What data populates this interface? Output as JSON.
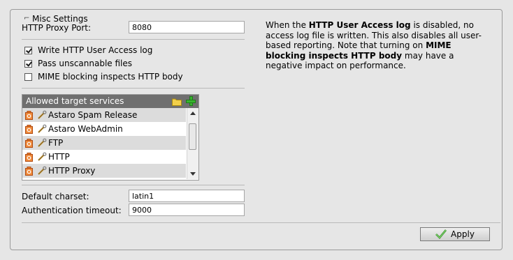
{
  "panel": {
    "title": "Misc Settings"
  },
  "proxy_port": {
    "label": "HTTP Proxy Port:",
    "value": "8080"
  },
  "checkboxes": [
    {
      "label": "Write HTTP User Access log",
      "checked": true
    },
    {
      "label": "Pass unscannable files",
      "checked": true
    },
    {
      "label": "MIME blocking inspects HTTP body",
      "checked": false
    }
  ],
  "services": {
    "header": "Allowed target services",
    "items": [
      {
        "label": "Astaro Spam Release"
      },
      {
        "label": "Astaro WebAdmin"
      },
      {
        "label": "FTP"
      },
      {
        "label": "HTTP"
      },
      {
        "label": "HTTP Proxy"
      }
    ]
  },
  "charset": {
    "label": "Default charset:",
    "value": "latin1"
  },
  "auth_timeout": {
    "label": "Authentication timeout:",
    "value": "9000"
  },
  "info": {
    "t1": "When the ",
    "b1": "HTTP User Access log",
    "t2": " is disabled, no access log file is written. This also disables all user-based reporting. Note that turning on ",
    "b2": "MIME blocking inspects HTTP body",
    "t3": " may have a negative impact on performance."
  },
  "apply_label": "Apply",
  "colors": {
    "accent_green": "#37b32e",
    "header_gray": "#6f6f6f",
    "row_shade": "#dcdcdc"
  }
}
